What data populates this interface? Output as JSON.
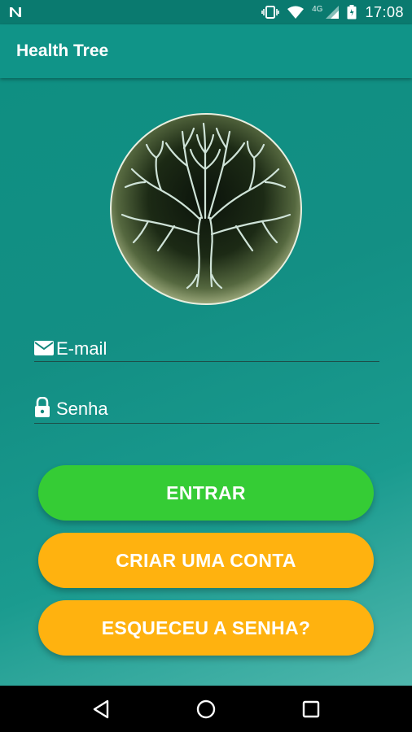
{
  "status_bar": {
    "network_label": "4G",
    "time": "17:08",
    "icons": [
      "notification-n-icon",
      "vibrate-icon",
      "wifi-icon",
      "signal-icon",
      "battery-icon"
    ]
  },
  "app_bar": {
    "title": "Health Tree"
  },
  "logo": {
    "icon": "tree-logo-icon"
  },
  "form": {
    "email": {
      "label": "E-mail",
      "icon": "envelope-icon"
    },
    "password": {
      "label": "Senha",
      "icon": "lock-icon"
    }
  },
  "buttons": {
    "enter": "ENTRAR",
    "create_account": "CRIAR UMA CONTA",
    "forgot_password": "ESQUECEU A SENHA?"
  },
  "nav_bar": {
    "icons": [
      "back-icon",
      "home-icon",
      "recents-icon"
    ]
  },
  "colors": {
    "primary": "#109488",
    "status_bar": "#0a7a6f",
    "enter_button": "#35cc35",
    "secondary_button": "#ffb20f"
  }
}
